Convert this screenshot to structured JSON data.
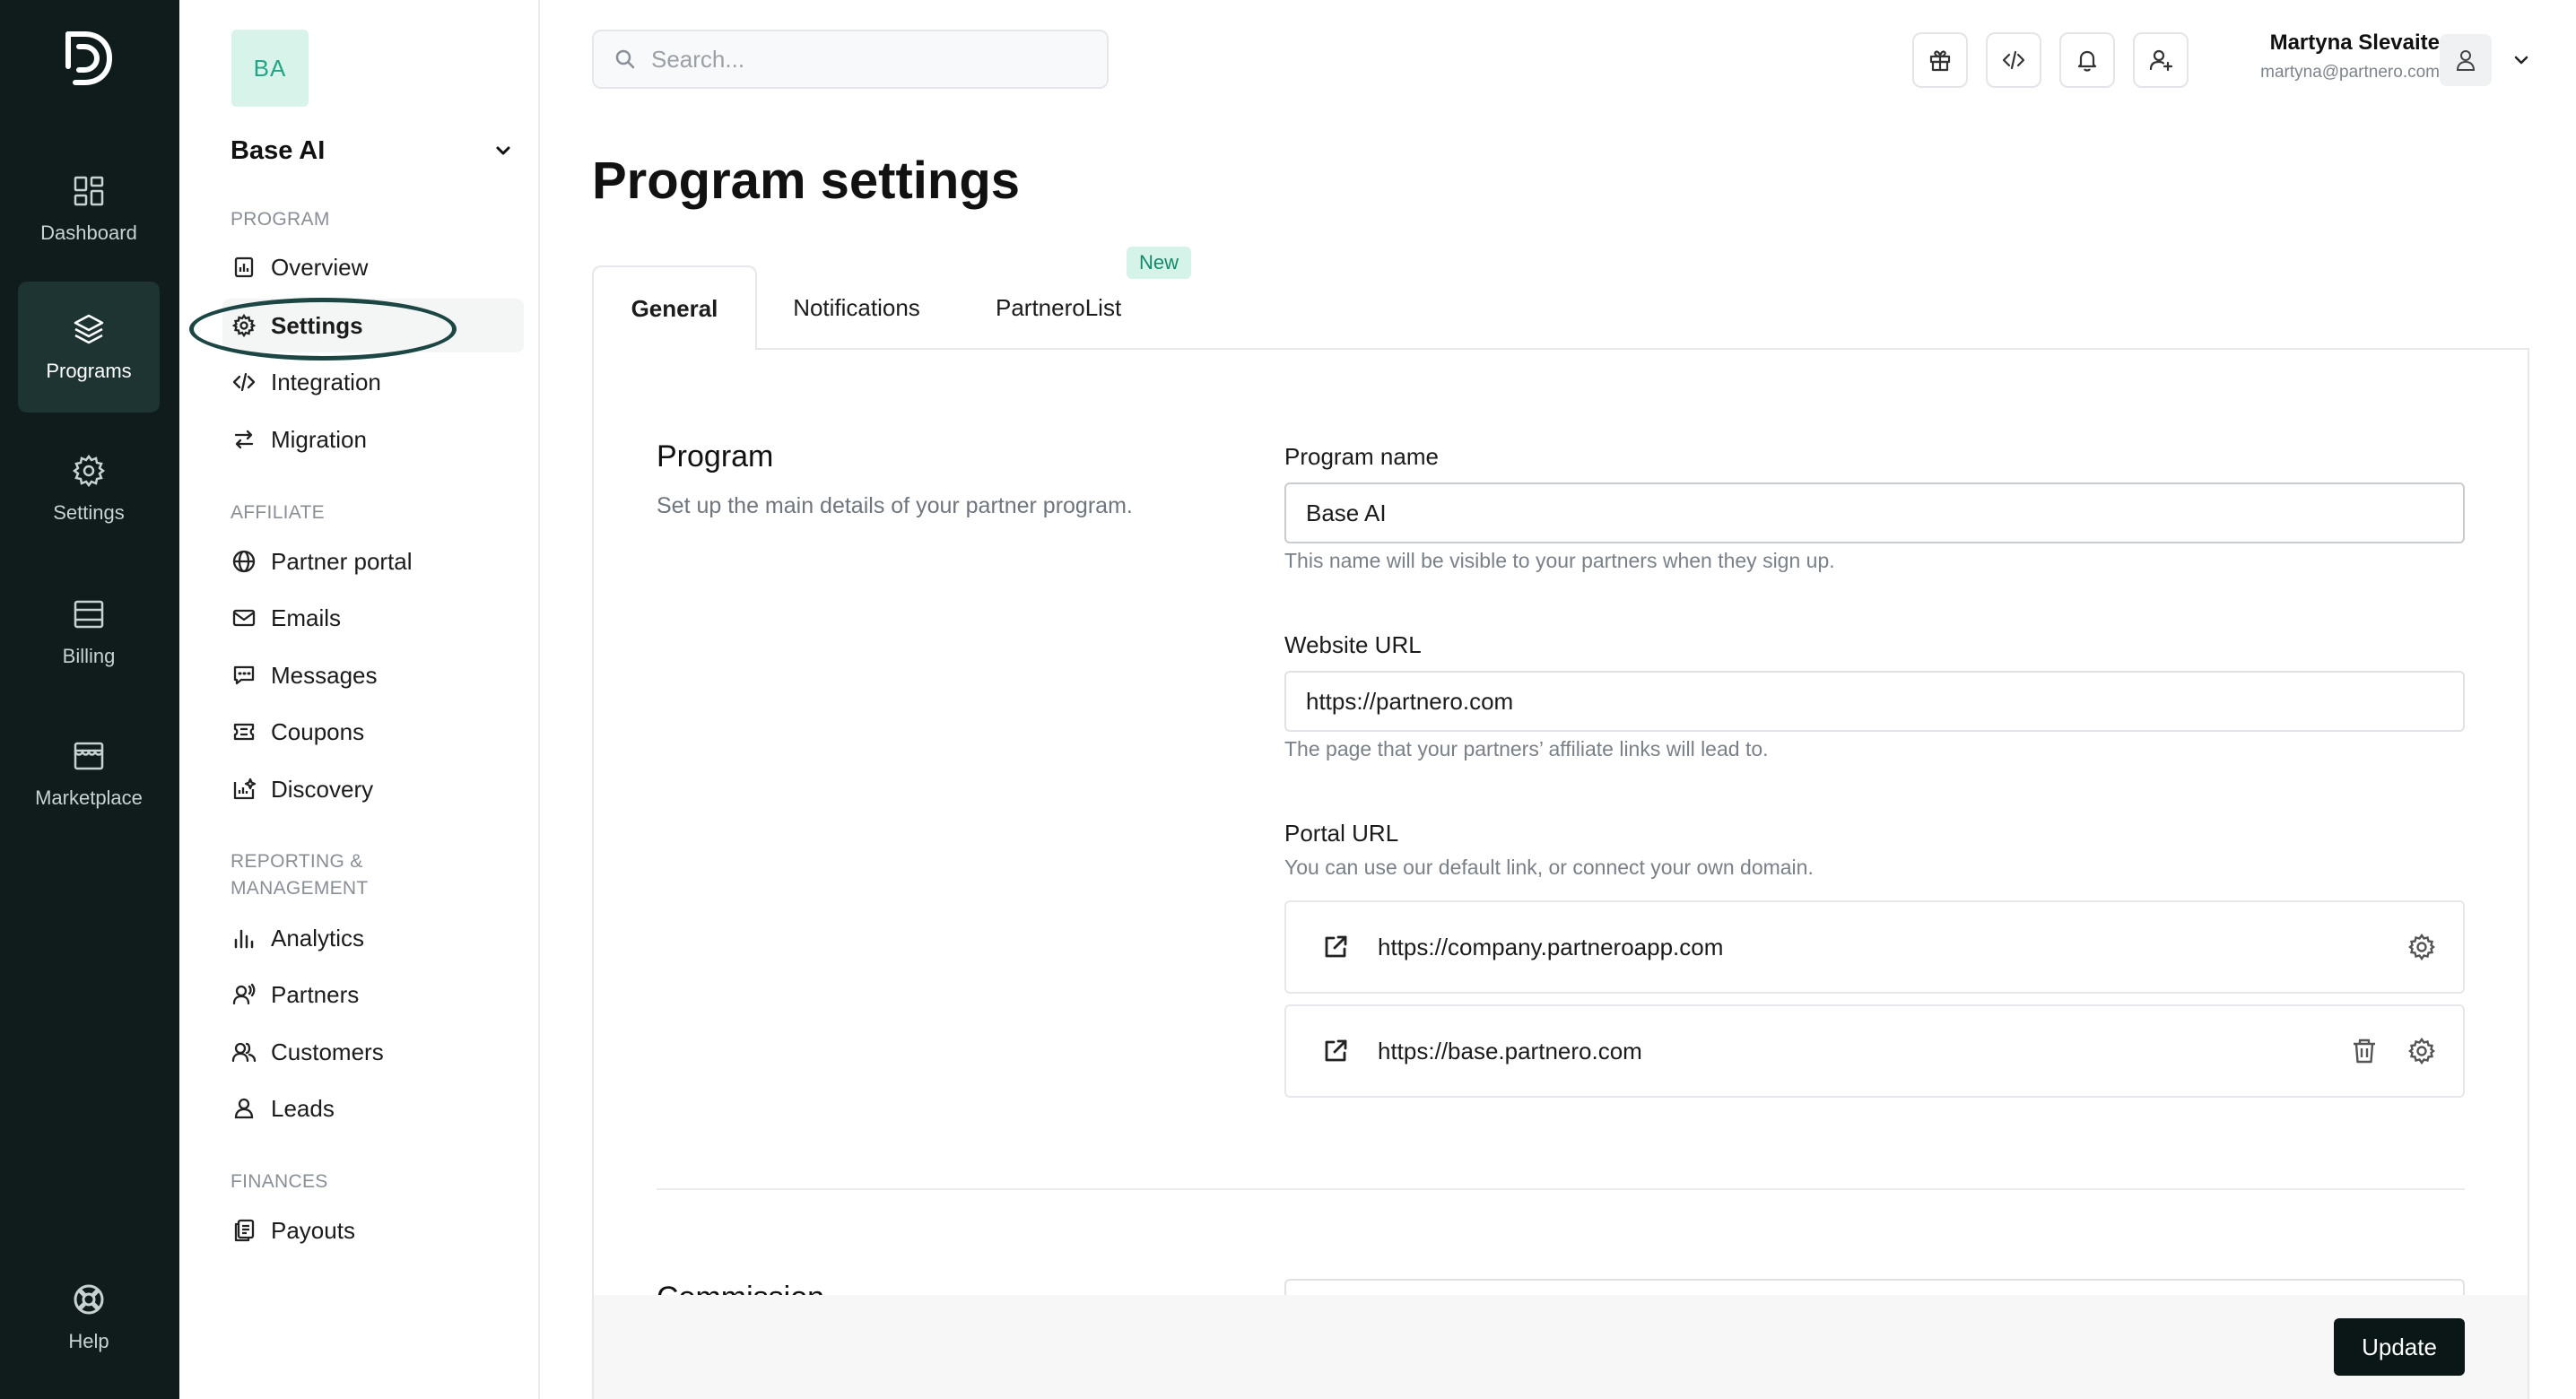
{
  "rail": {
    "items": [
      {
        "label": "Dashboard",
        "icon": "dashboard-icon"
      },
      {
        "label": "Programs",
        "icon": "layers-icon",
        "active": true
      },
      {
        "label": "Settings",
        "icon": "gear-icon"
      },
      {
        "label": "Billing",
        "icon": "billing-icon"
      },
      {
        "label": "Marketplace",
        "icon": "store-icon"
      }
    ],
    "help": {
      "label": "Help",
      "icon": "lifebuoy-icon"
    }
  },
  "sidebar": {
    "program_initials": "BA",
    "program_name": "Base AI",
    "sections": [
      {
        "label": "PROGRAM",
        "items": [
          "Overview",
          "Settings",
          "Integration",
          "Migration"
        ]
      },
      {
        "label": "AFFILIATE",
        "items": [
          "Partner portal",
          "Emails",
          "Messages",
          "Coupons",
          "Discovery"
        ]
      },
      {
        "label_line1": "REPORTING &",
        "label_line2": "MANAGEMENT",
        "items": [
          "Analytics",
          "Partners",
          "Customers",
          "Leads"
        ]
      },
      {
        "label": "FINANCES",
        "items": [
          "Payouts"
        ]
      }
    ],
    "active_item": "Settings"
  },
  "topbar": {
    "search_placeholder": "Search...",
    "user_name": "Martyna Slevaite",
    "user_email": "martyna@partnero.com"
  },
  "main": {
    "title": "Program settings",
    "tabs": [
      {
        "label": "General",
        "active": true
      },
      {
        "label": "Notifications"
      },
      {
        "label": "PartneroList",
        "badge": "New"
      }
    ],
    "program_section": {
      "title": "Program",
      "description": "Set up the main details of your partner program."
    },
    "fields": {
      "program_name": {
        "label": "Program name",
        "value": "Base AI",
        "help": "This name will be visible to your partners when they sign up."
      },
      "website_url": {
        "label": "Website URL",
        "value": "https://partnero.com",
        "help": "The page that your partners’ affiliate links will lead to."
      },
      "portal_url": {
        "label": "Portal URL",
        "help": "You can use our default link, or connect your own domain.",
        "urls": [
          "https://company.partneroapp.com",
          "https://base.partnero.com"
        ]
      }
    },
    "next_section_title": "Commission",
    "update_label": "Update"
  },
  "colors": {
    "rail_bg": "#0f1c1b",
    "accent_green": "#21a584",
    "primary_button": "#0b1716"
  }
}
